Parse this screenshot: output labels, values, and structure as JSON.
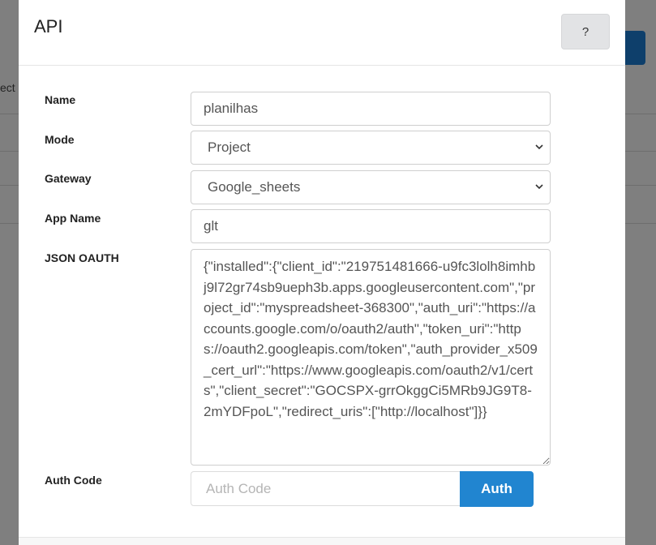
{
  "background": {
    "partial_text": "ect"
  },
  "modal": {
    "title": "API",
    "help_label": "?"
  },
  "form": {
    "name": {
      "label": "Name",
      "value": "planilhas"
    },
    "mode": {
      "label": "Mode",
      "value": "Project"
    },
    "gateway": {
      "label": "Gateway",
      "value": "Google_sheets"
    },
    "app_name": {
      "label": "App Name",
      "value": "glt"
    },
    "json_oauth": {
      "label": "JSON OAUTH",
      "value": "{\"installed\":{\"client_id\":\"219751481666-u9fc3lolh8imhbj9l72gr74sb9ueph3b.apps.googleusercontent.com\",\"project_id\":\"myspreadsheet-368300\",\"auth_uri\":\"https://accounts.google.com/o/oauth2/auth\",\"token_uri\":\"https://oauth2.googleapis.com/token\",\"auth_provider_x509_cert_url\":\"https://www.googleapis.com/oauth2/v1/certs\",\"client_secret\":\"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\",\"redirect_uris\":[\"http://localhost\"]}}"
    },
    "auth_code": {
      "label": "Auth Code",
      "placeholder": "Auth Code",
      "button_label": "Auth"
    }
  },
  "colors": {
    "accent": "#2185d0",
    "overlay": "#7f7f7f",
    "help_button_bg": "#e2e3e5"
  }
}
